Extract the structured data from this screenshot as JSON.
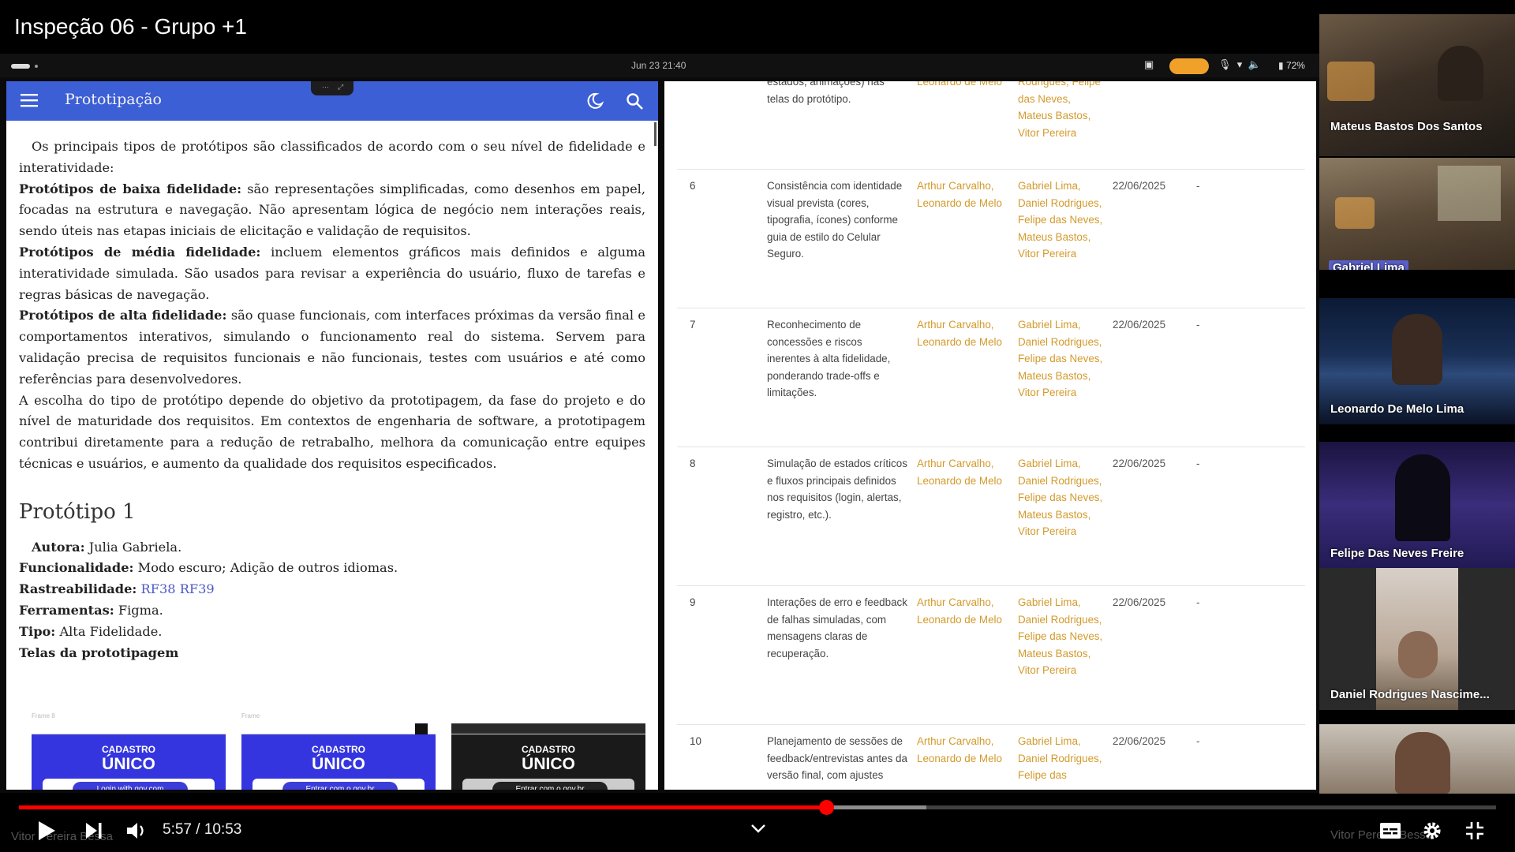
{
  "video": {
    "title": "Inspeção 06 - Grupo +1",
    "time": "5:57 / 10:53",
    "progress_fraction": 0.547
  },
  "tablet": {
    "datetime": "Jun 23  21:40",
    "battery": "72%"
  },
  "doc": {
    "app_title": "Prototipação",
    "intro": "Os principais tipos de protótipos são classificados de acordo com o seu nível de fidelidade e interatividade:",
    "low_label": "Protótipos de baixa fidelidade:",
    "low_text": " são representações simplificadas, como desenhos em papel, focadas na estrutura e navegação. Não apresentam lógica de negócio nem interações reais, sendo úteis nas etapas iniciais de elicitação e validação de requisitos.",
    "mid_label": "Protótipos de média fidelidade:",
    "mid_text": " incluem elementos gráficos mais definidos e alguma interatividade simulada. São usados para revisar a experiência do usuário, fluxo de tarefas e regras básicas de navegação.",
    "high_label": "Protótipos de alta fidelidade:",
    "high_text": " são quase funcionais, com interfaces próximas da versão final e comportamentos interativos, simulando o funcionamento real do sistema. Servem para validação precisa de requisitos funcionais e não funcionais, testes com usuários e até como referências para desenvolvedores.",
    "closing": "A escolha do tipo de protótipo depende do objetivo da prototipagem, da fase do projeto e do nível de maturidade dos requisitos. Em contextos de engenharia de software, a prototipagem contribui diretamente para a redução de retrabalho, melhora da comunicação entre equipes técnicas e usuários, e aumento da qualidade dos requisitos especificados.",
    "section_title": "Protótipo 1",
    "author_label": "Autora:",
    "author_value": " Julia Gabriela.",
    "func_label": "Funcionalidade:",
    "func_value": " Modo escuro; Adição de outros idiomas.",
    "trace_label": "Rastreabilidade:",
    "trace_value": "RF38 RF39",
    "tools_label": "Ferramentas:",
    "tools_value": " Figma.",
    "type_label": "Tipo:",
    "type_value": " Alta Fidelidade.",
    "screens_label": "Telas da prototipagem",
    "screens": [
      {
        "frame": "Frame 8",
        "line1": "CADASTRO",
        "line2": "ÚNICO",
        "button": "Login with gov.com",
        "dark": false
      },
      {
        "frame": "Frame",
        "line1": "CADASTRO",
        "line2": "ÚNICO",
        "button": "Entrar com o gov.br",
        "dark": false
      },
      {
        "frame": "",
        "line1": "CADASTRO",
        "line2": "ÚNICO",
        "button": "Entrar com o gov.br",
        "dark": true
      }
    ]
  },
  "table": {
    "top_partial": {
      "desc": "estados, animações) nas telas do protótipo.",
      "resp": "Leonardo de Melo",
      "part": "Rodrigues, Felipe das Neves, Mateus Bastos, Vitor Pereira"
    },
    "rows": [
      {
        "num": "6",
        "desc": "Consistência com identidade visual prevista (cores, tipografia, ícones) conforme guia de estilo do Celular Seguro.",
        "resp": "Arthur Carvalho, Leonardo de Melo",
        "part": "Gabriel Lima, Daniel Rodrigues, Felipe das Neves, Mateus Bastos, Vitor Pereira",
        "date": "22/06/2025",
        "dash": "-"
      },
      {
        "num": "7",
        "desc": "Reconhecimento de concessões e riscos inerentes à alta fidelidade, ponderando trade-offs e limitações.",
        "resp": "Arthur Carvalho, Leonardo de Melo",
        "part": "Gabriel Lima, Daniel Rodrigues, Felipe das Neves, Mateus Bastos, Vitor Pereira",
        "date": "22/06/2025",
        "dash": "-"
      },
      {
        "num": "8",
        "desc": "Simulação de estados críticos e fluxos principais definidos nos requisitos (login, alertas, registro, etc.).",
        "resp": "Arthur Carvalho, Leonardo de Melo",
        "part": "Gabriel Lima, Daniel Rodrigues, Felipe das Neves, Mateus Bastos, Vitor Pereira",
        "date": "22/06/2025",
        "dash": "-"
      },
      {
        "num": "9",
        "desc": "Interações de erro e feedback de falhas simuladas, com mensagens claras de recuperação.",
        "resp": "Arthur Carvalho, Leonardo de Melo",
        "part": "Gabriel Lima, Daniel Rodrigues, Felipe das Neves, Mateus Bastos, Vitor Pereira",
        "date": "22/06/2025",
        "dash": "-"
      },
      {
        "num": "10",
        "desc": "Planejamento de sessões de feedback/entrevistas antes da versão final, com ajustes",
        "resp": "Arthur Carvalho, Leonardo de Melo",
        "part": "Gabriel Lima, Daniel Rodrigues, Felipe das",
        "date": "22/06/2025",
        "dash": "-"
      }
    ]
  },
  "participants": [
    {
      "name": "Mateus Bastos Dos Santos",
      "highlight": false
    },
    {
      "name": "Gabriel Lima",
      "highlight": true
    },
    {
      "name": "Leonardo De Melo Lima",
      "highlight": false
    },
    {
      "name": "Felipe Das Neves Freire",
      "highlight": false
    },
    {
      "name": "Daniel Rodrigues Nascime...",
      "highlight": false
    },
    {
      "name": "Vitor Pereira Bessa",
      "highlight": false
    }
  ],
  "colors": {
    "app_bar": "#3c5fd6",
    "responsible_text": "#d39a2c",
    "progress": "#ff0000",
    "participant_highlight": "#5a5fc8"
  },
  "icons": {
    "menu": "menu-icon",
    "dark_mode": "moon-icon",
    "search": "search-icon",
    "share": "share-icon",
    "play": "play-icon",
    "next": "next-icon",
    "volume": "volume-icon",
    "subtitles": "subtitles-icon",
    "settings": "gear-icon",
    "exit_fullscreen": "exit-fullscreen-icon",
    "chevron": "chevron-down-icon"
  }
}
